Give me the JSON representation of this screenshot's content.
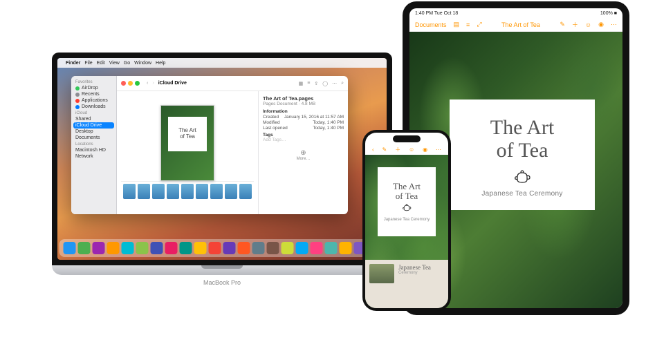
{
  "mac": {
    "menubar": {
      "apple": "",
      "app": "Finder",
      "items": [
        "File",
        "Edit",
        "View",
        "Go",
        "Window",
        "Help"
      ]
    },
    "finder": {
      "title": "iCloud Drive",
      "sidebar": {
        "favorites_label": "Favorites",
        "favorites": [
          {
            "label": "AirDrop",
            "color": "#34c759"
          },
          {
            "label": "Recents",
            "color": "#8e8e93"
          },
          {
            "label": "Applications",
            "color": "#ff3b30"
          },
          {
            "label": "Downloads",
            "color": "#007aff"
          }
        ],
        "icloud_label": "iCloud",
        "icloud": [
          {
            "label": "Shared"
          },
          {
            "label": "iCloud Drive",
            "selected": true
          },
          {
            "label": "Desktop"
          },
          {
            "label": "Documents"
          }
        ],
        "locations_label": "Locations",
        "locations": [
          {
            "label": "Macintosh HD"
          },
          {
            "label": "Network"
          }
        ]
      },
      "preview_doc_title": "The Art\nof Tea",
      "info": {
        "filename": "The Art of Tea.pages",
        "subtitle": "Pages Document · 4.8 MB",
        "section_info": "Information",
        "rows": [
          {
            "k": "Created",
            "v": "January 15, 2016 at 11:57 AM"
          },
          {
            "k": "Modified",
            "v": "Today, 1:40 PM"
          },
          {
            "k": "Last opened",
            "v": "Today, 1:40 PM"
          }
        ],
        "tags_label": "Tags",
        "tags_placeholder": "Add Tags…",
        "more_label": "More…"
      }
    },
    "dock_colors": [
      "#2196f3",
      "#4caf50",
      "#9c27b0",
      "#ff9800",
      "#00bcd4",
      "#8bc34a",
      "#3f51b5",
      "#e91e63",
      "#009688",
      "#ffc107",
      "#f44336",
      "#673ab7",
      "#ff5722",
      "#607d8b",
      "#795548",
      "#cddc39",
      "#03a9f4",
      "#ff4081",
      "#4db6ac",
      "#ffb300",
      "#7e57c2",
      "#26a69a"
    ],
    "label": "MacBook Pro"
  },
  "iphone": {
    "toolbar_back": "‹",
    "card_title": "The Art\nof Tea",
    "card_sub": "Japanese Tea Ceremony",
    "section2_title": "Japanese Tea",
    "section2_sub": "Ceremony"
  },
  "ipad": {
    "status": {
      "time": "1:40 PM  Tue Oct 18",
      "right": "100%"
    },
    "toolbar": {
      "documents": "Documents",
      "title": "The Art of Tea"
    },
    "card_title": "The Art\nof Tea",
    "card_sub": "Japanese Tea Ceremony"
  }
}
